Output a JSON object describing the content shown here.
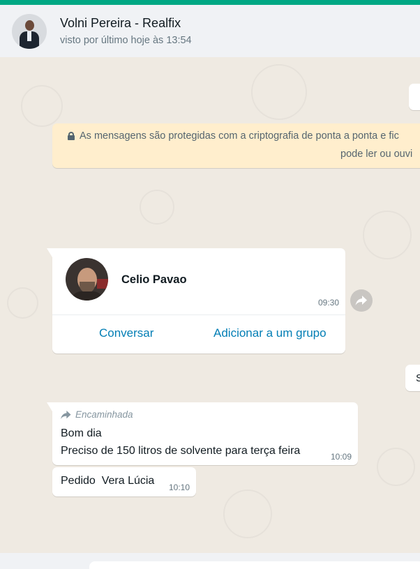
{
  "colors": {
    "accent": "#00a884",
    "chat_background": "#efeae2",
    "header_background": "#f0f2f5",
    "encryption_notice_background": "#ffeecd",
    "link": "#027eb5"
  },
  "header": {
    "contact_name": "Volni Pereira - Realfix",
    "status": "visto por último hoje às 13:54",
    "avatar_icon": "person-avatar"
  },
  "encryption_notice": {
    "icon": "lock-icon",
    "line1": "As mensagens são protegidas com a criptografia de ponta a ponta e fic",
    "line2": "pode ler ou ouvi"
  },
  "right_side_bubbles": {
    "top_fragment": "",
    "middle_fragment": "S"
  },
  "contact_card": {
    "name": "Celio Pavao",
    "time": "09:30",
    "actions": {
      "chat": "Conversar",
      "add_to_group": "Adicionar a um grupo"
    },
    "forward_icon": "forward-arrow-icon"
  },
  "messages": [
    {
      "forwarded_label": "Encaminhada",
      "lines": [
        "Bom dia",
        "Preciso de 150 litros de solvente para terça feira"
      ],
      "time": "10:09"
    },
    {
      "text": "Pedido  Vera Lúcia",
      "time": "10:10"
    }
  ]
}
